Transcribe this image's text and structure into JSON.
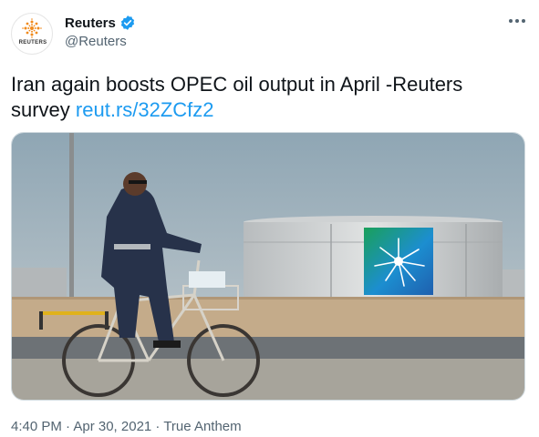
{
  "author": {
    "display_name": "Reuters",
    "handle": "@Reuters",
    "avatar_text": "REUTERS",
    "verified": true
  },
  "tweet": {
    "text": "Iran again boosts OPEC oil output in April -Reuters survey",
    "link": "reut.rs/32ZCfz2"
  },
  "meta": {
    "timestamp": "4:40 PM · Apr 30, 2021 · True Anthem"
  },
  "icons": {
    "verified": "verified-badge-icon",
    "more": "more-options-icon"
  },
  "colors": {
    "link": "#1d9bf0",
    "verified": "#1d9bf0",
    "secondary_text": "#536471"
  }
}
